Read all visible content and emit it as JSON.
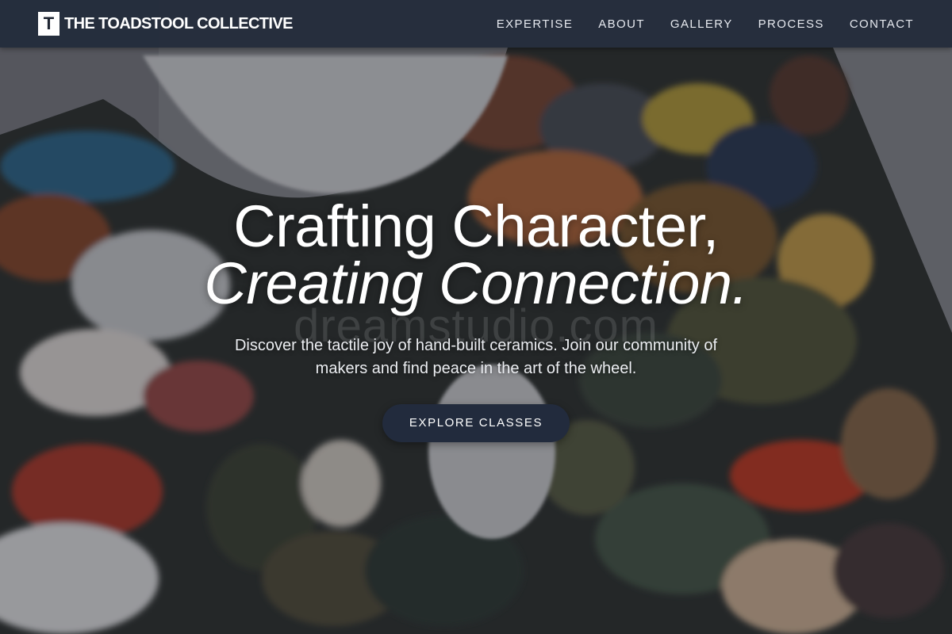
{
  "nav": {
    "brand_mark": "T",
    "brand_name": "THE TOADSTOOL COLLECTIVE",
    "links": [
      {
        "label": "EXPERTISE"
      },
      {
        "label": "ABOUT"
      },
      {
        "label": "GALLERY"
      },
      {
        "label": "PROCESS"
      },
      {
        "label": "CONTACT"
      }
    ]
  },
  "hero": {
    "headline_line1": "Crafting Character,",
    "headline_line2": "Creating Connection.",
    "subtext": "Discover the tactile joy of hand-built ceramics. Join our community of makers and find peace in the art of the wheel.",
    "cta_label": "EXPLORE CLASSES",
    "watermark": "dreamstudio.com",
    "background_image": "paint-palette-photo"
  },
  "colors": {
    "navbar_bg": "#242c3c",
    "cta_bg": "#222b3d",
    "text_light": "#ffffff"
  }
}
